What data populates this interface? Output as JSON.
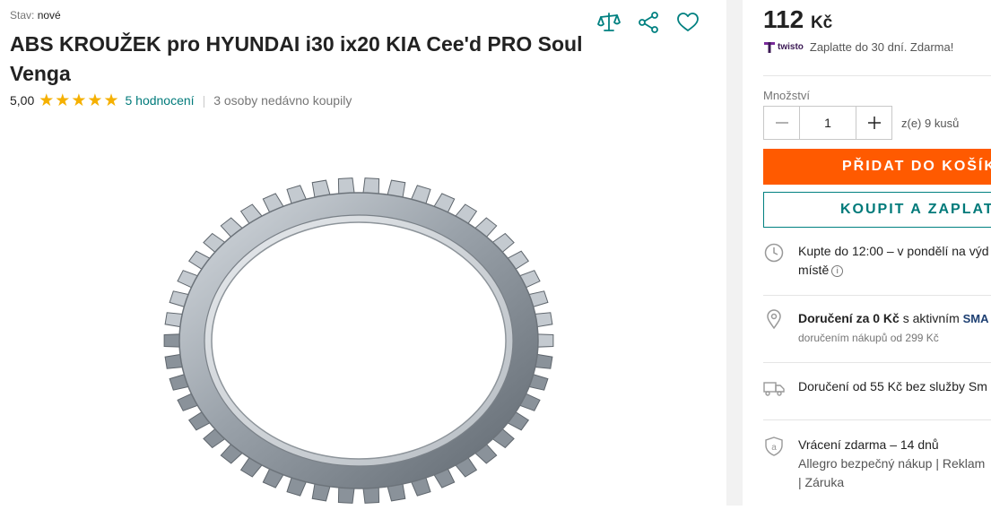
{
  "product": {
    "condition_label": "Stav:",
    "condition_value": "nové",
    "title": "ABS KROUŽEK pro HYUNDAI i30 ix20 KIA Cee'd PRO Soul Venga",
    "rating_value": "5,00",
    "stars": 5,
    "reviews_link": "5 hodnocení",
    "recent_buyers": "3 osoby nedávno koupily",
    "image_icon": "abs-toothed-ring"
  },
  "actions": {
    "compare_icon": "scales-icon",
    "share_icon": "share-icon",
    "favorite_icon": "heart-icon"
  },
  "purchase": {
    "price": "112",
    "currency": "Kč",
    "twisto_brand": "twisto",
    "twisto_text": "Zaplatte do 30 dní. Zdarma!",
    "quantity_label": "Množství",
    "quantity_value": "1",
    "availability": "z(e) 9 kusů",
    "add_to_cart": "PŘIDAT DO KOŠÍK",
    "buy_now": "KOUPIT A ZAPLAT"
  },
  "info": {
    "delivery_time": "Kupte do 12:00 – v pondělí na výd",
    "delivery_time_line2": "místě",
    "free_delivery_bold": "Doručení za 0 Kč",
    "free_delivery_text": " s aktivním ",
    "free_delivery_brand": "SMA",
    "free_delivery_sub": "doručením nákupů od 299 Kč",
    "paid_delivery": "Doručení od 55 Kč bez služby Sm",
    "returns": "Vrácení zdarma – 14 dnů",
    "returns_line2": "Allegro bezpečný nákup | Reklam",
    "returns_line3": "| Záruka"
  },
  "colors": {
    "accent_teal": "#008080",
    "cta_orange": "#ff5a00",
    "star": "#f5b000"
  }
}
